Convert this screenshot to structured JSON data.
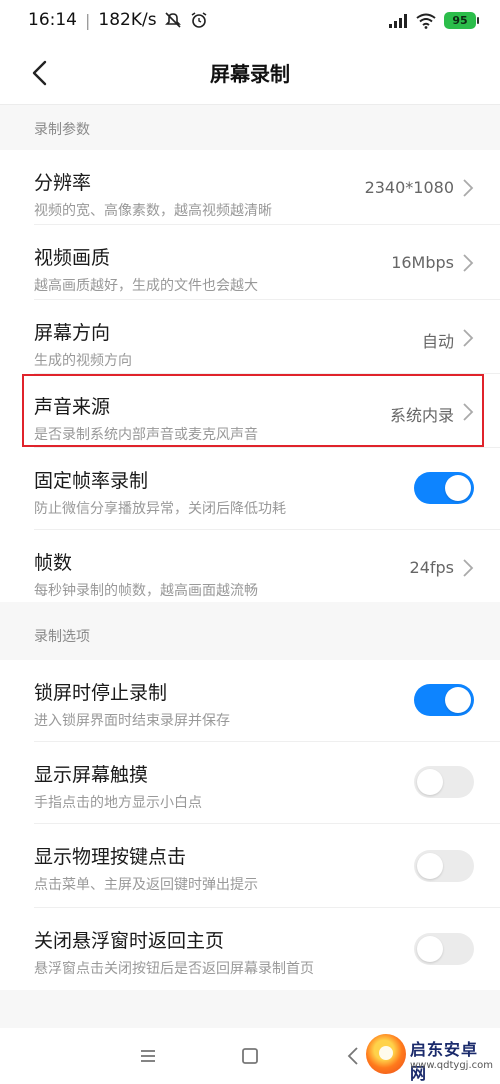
{
  "status_bar": {
    "time": "16:14",
    "separator": "|",
    "speed": "182K/s",
    "battery": "95"
  },
  "header": {
    "title": "屏幕录制"
  },
  "sections": [
    {
      "header": "录制参数",
      "rows": [
        {
          "title": "分辨率",
          "subtitle": "视频的宽、高像素数，越高视频越清晰",
          "value": "2340*1080"
        },
        {
          "title": "视频画质",
          "subtitle": "越高画质越好，生成的文件也会越大",
          "value": "16Mbps"
        },
        {
          "title": "屏幕方向",
          "subtitle": "生成的视频方向",
          "value": "自动"
        },
        {
          "title": "声音来源",
          "subtitle": "是否录制系统内部声音或麦克风声音",
          "value": "系统内录"
        },
        {
          "title": "固定帧率录制",
          "subtitle": "防止微信分享播放异常，关闭后降低功耗",
          "toggle": true
        },
        {
          "title": "帧数",
          "subtitle": "每秒钟录制的帧数，越高画面越流畅",
          "value": "24fps"
        }
      ]
    },
    {
      "header": "录制选项",
      "rows": [
        {
          "title": "锁屏时停止录制",
          "subtitle": "进入锁屏界面时结束录屏并保存",
          "toggle": true
        },
        {
          "title": "显示屏幕触摸",
          "subtitle": "手指点击的地方显示小白点",
          "toggle": false
        },
        {
          "title": "显示物理按键点击",
          "subtitle": "点击菜单、主屏及返回键时弹出提示",
          "toggle": false
        },
        {
          "title": "关闭悬浮窗时返回主页",
          "subtitle": "悬浮窗点击关闭按钮后是否返回屏幕录制首页",
          "toggle": false
        }
      ]
    }
  ],
  "watermark": {
    "name": "启东安卓网",
    "url": "www.qdtygj.com"
  },
  "colors": {
    "accent": "#0d84ff",
    "highlight": "#e0232b",
    "section_bg": "#f7f7f7"
  },
  "icons": {
    "back": "chevron-left-icon",
    "row_arrow": "chevron-right-icon",
    "nav_menu": "menu-icon",
    "nav_home": "home-icon",
    "nav_back": "back-icon"
  }
}
